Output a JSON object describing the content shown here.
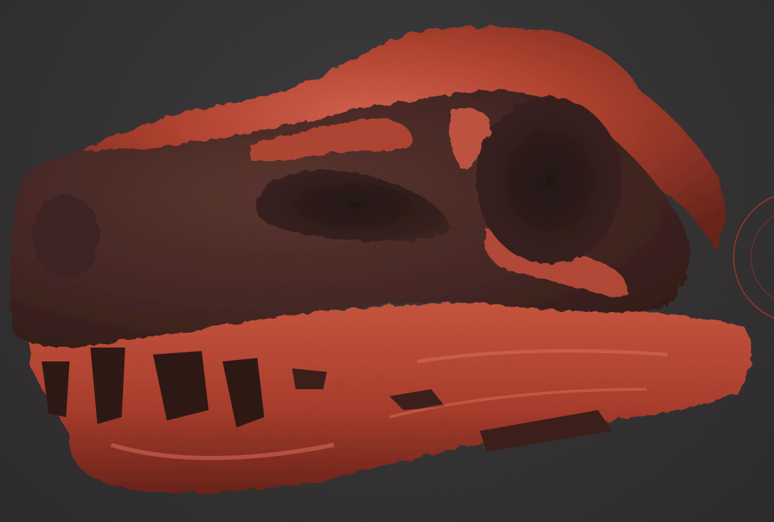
{
  "viewport": {
    "background_color": "#2e2f31",
    "model_subject": "skull-sculpt",
    "material_colors": {
      "base_red": "#b2402f",
      "highlight_red": "#d9604a",
      "shadow_red": "#5a2019",
      "dark_matte": "#4a2a26",
      "deep_cavity": "#231211"
    },
    "brush_cursor_color": "#c2302a"
  }
}
